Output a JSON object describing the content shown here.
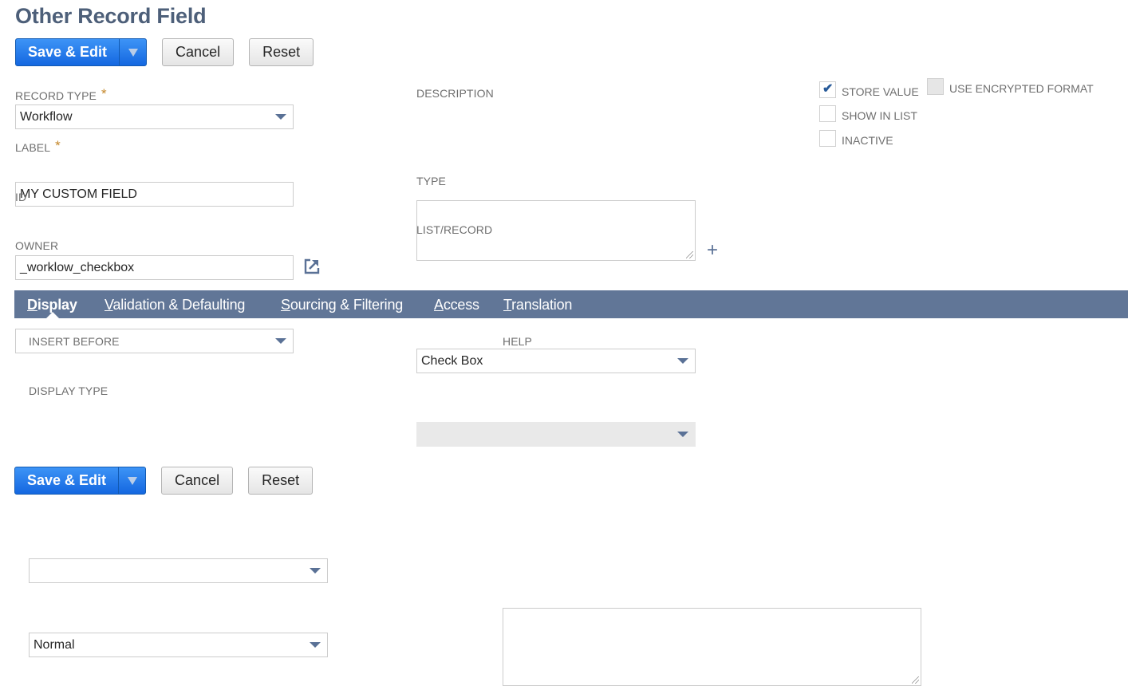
{
  "page": {
    "title": "Other Record Field"
  },
  "toolbar": {
    "save_edit_label": "Save & Edit",
    "cancel_label": "Cancel",
    "reset_label": "Reset"
  },
  "form": {
    "record_type": {
      "label": "Record Type",
      "value": "Workflow",
      "required": true
    },
    "label": {
      "label": "Label",
      "value": "MY CUSTOM FIELD",
      "required": true
    },
    "id": {
      "label": "ID",
      "value": "_worklow_checkbox"
    },
    "owner": {
      "label": "Owner",
      "value": ""
    },
    "description": {
      "label": "Description",
      "value": ""
    },
    "type": {
      "label": "Type",
      "value": "Check Box"
    },
    "list_record": {
      "label": "List/Record",
      "value": "",
      "disabled": true
    },
    "checkboxes": {
      "store_value": {
        "label": "Store Value",
        "checked": true
      },
      "use_encrypted_format": {
        "label": "Use Encrypted Format",
        "checked": false,
        "disabled": true
      },
      "show_in_list": {
        "label": "Show in List",
        "checked": false
      },
      "inactive": {
        "label": "Inactive",
        "checked": false
      }
    }
  },
  "tabs": [
    {
      "label": "Display",
      "first": "D",
      "rest": "isplay",
      "active": true
    },
    {
      "label": "Validation & Defaulting",
      "first": "V",
      "rest": "alidation & Defaulting",
      "active": false
    },
    {
      "label": "Sourcing & Filtering",
      "first": "S",
      "rest": "ourcing & Filtering",
      "active": false
    },
    {
      "label": "Access",
      "first": "A",
      "rest": "ccess",
      "active": false
    },
    {
      "label": "Translation",
      "first": "T",
      "rest": "ranslation",
      "active": false
    }
  ],
  "display_tab": {
    "insert_before": {
      "label": "Insert Before",
      "value": ""
    },
    "display_type": {
      "label": "Display Type",
      "value": "Normal"
    },
    "help": {
      "label": "Help",
      "value": ""
    }
  },
  "colors": {
    "primary_button": "#1f74e8",
    "tab_bar": "#617697",
    "title": "#4d5f79",
    "required_star": "#c4872a"
  }
}
